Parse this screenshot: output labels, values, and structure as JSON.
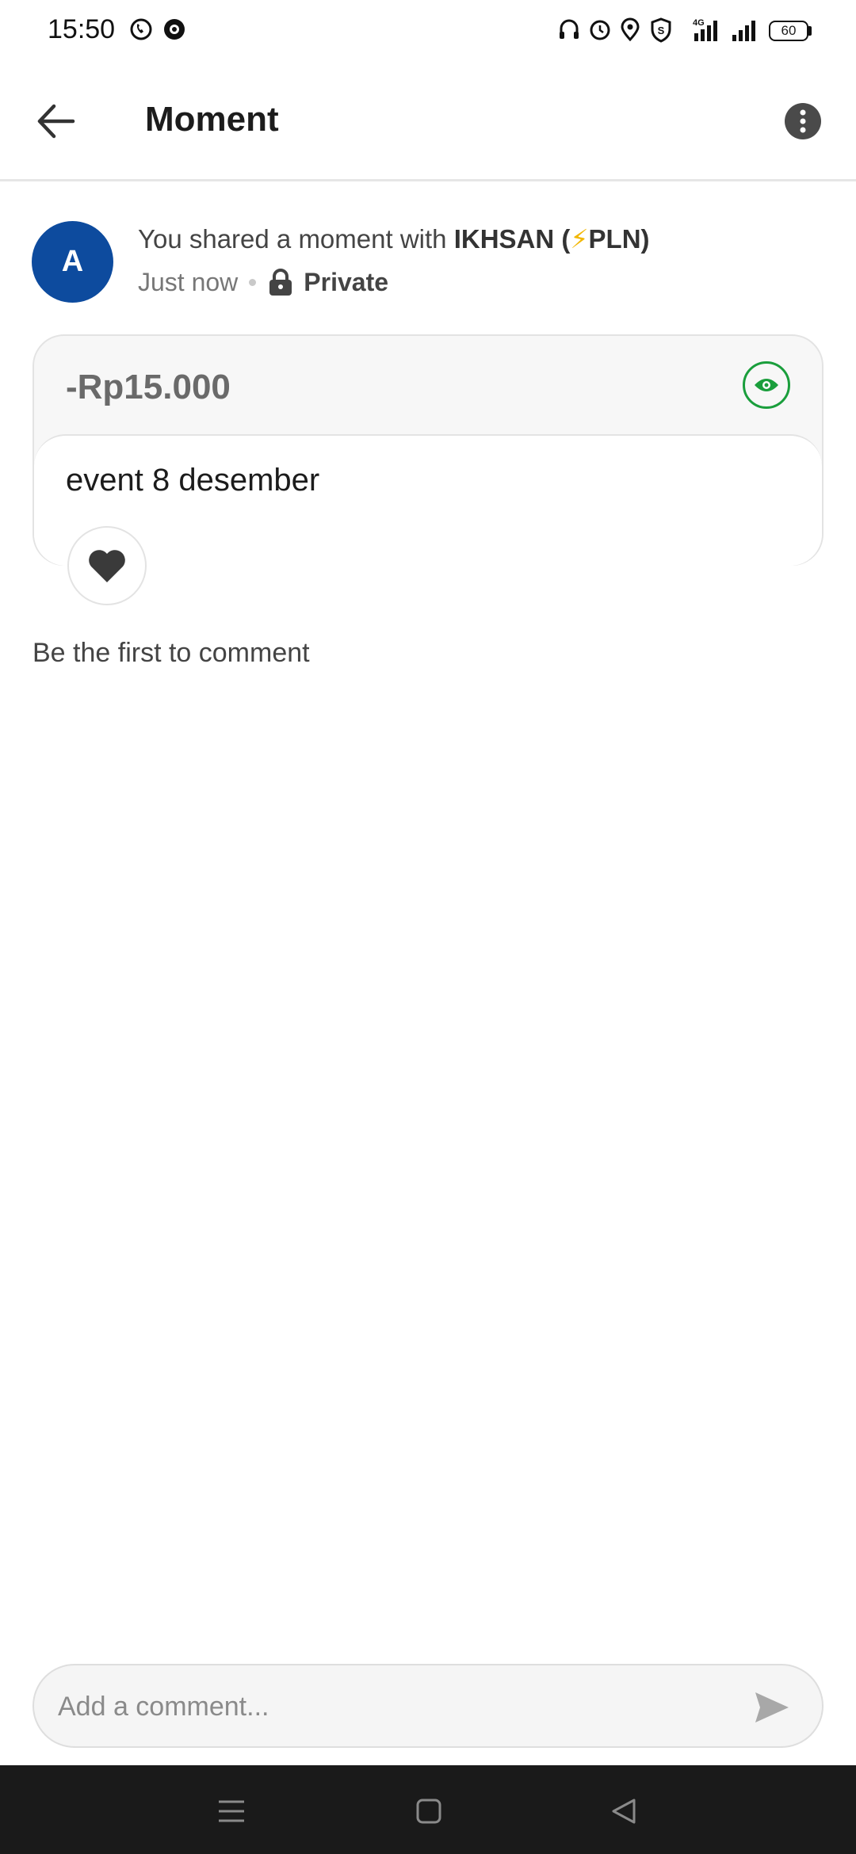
{
  "status_bar": {
    "time": "15:50",
    "network": "4G",
    "battery": "60"
  },
  "app_bar": {
    "title": "Moment"
  },
  "share": {
    "avatar_letter": "A",
    "prefix": "You shared a moment with ",
    "recipient": "IKHSAN (",
    "recipient_bolt": "⚡",
    "recipient_suffix": "PLN)",
    "time": "Just now",
    "visibility": "Private"
  },
  "card": {
    "amount": "-Rp15.000",
    "note": "event 8 desember",
    "accent_color": "#1a9e3c"
  },
  "comments": {
    "empty_text": "Be the first to comment",
    "placeholder": "Add a comment..."
  },
  "icons": {
    "back": "arrow-left-icon",
    "more": "more-vertical-icon",
    "lock": "lock-icon",
    "eye": "eye-icon",
    "like": "heart-icon",
    "send": "send-icon"
  }
}
